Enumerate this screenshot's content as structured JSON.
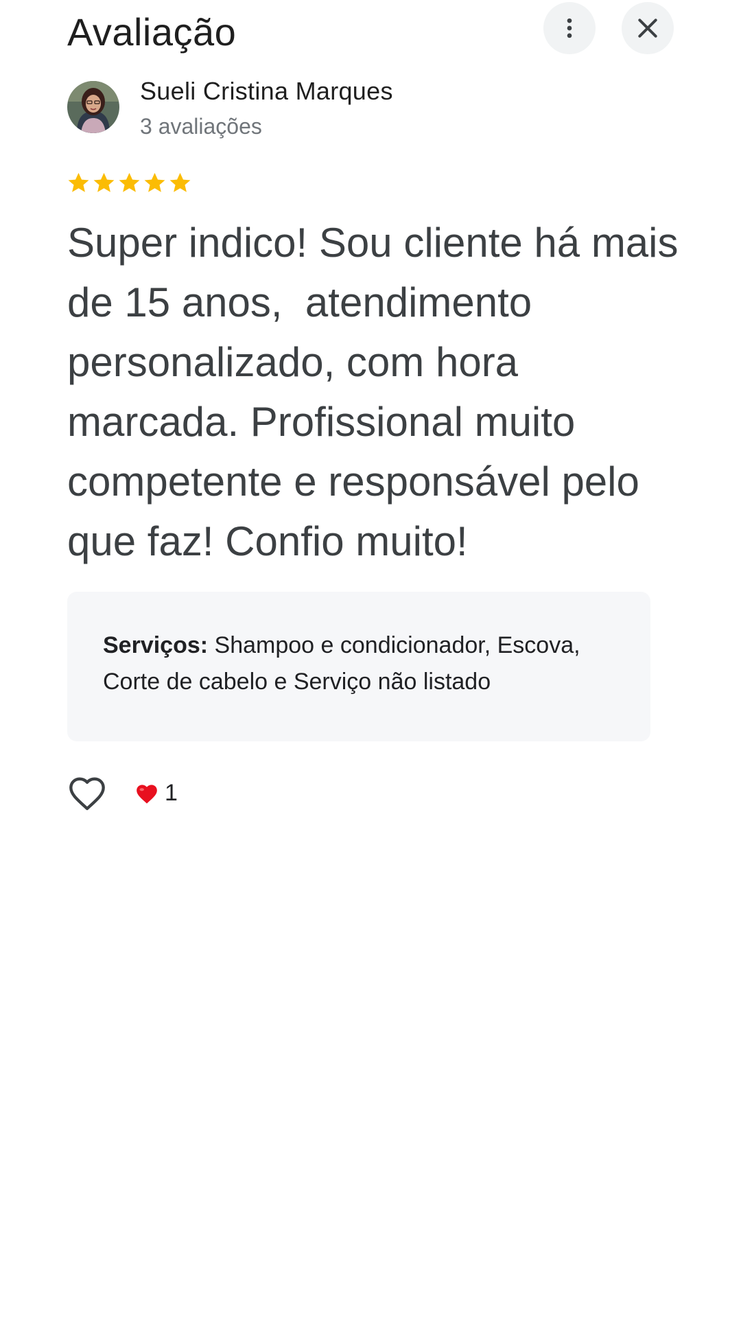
{
  "header": {
    "title": "Avaliação",
    "more_icon": "more-vert-icon",
    "close_icon": "close-icon"
  },
  "author": {
    "name": "Sueli Cristina Marques",
    "reviews_count": "3 avaliações"
  },
  "rating": {
    "stars": 5,
    "max": 5,
    "star_color": "#fbbc04"
  },
  "review": {
    "text": "Super indico! Sou cliente há mais de 15 anos,  atendimento personalizado, com hora marcada. Profissional muito competente e responsável pelo que faz! Confio muito!"
  },
  "services": {
    "label": "Serviços:",
    "value": "Shampoo e condicionador, Escova, Corte de cabelo e Serviço não listado"
  },
  "reactions": {
    "like_icon": "heart-outline-icon",
    "reaction_icon": "red-heart-icon",
    "count": "1"
  }
}
